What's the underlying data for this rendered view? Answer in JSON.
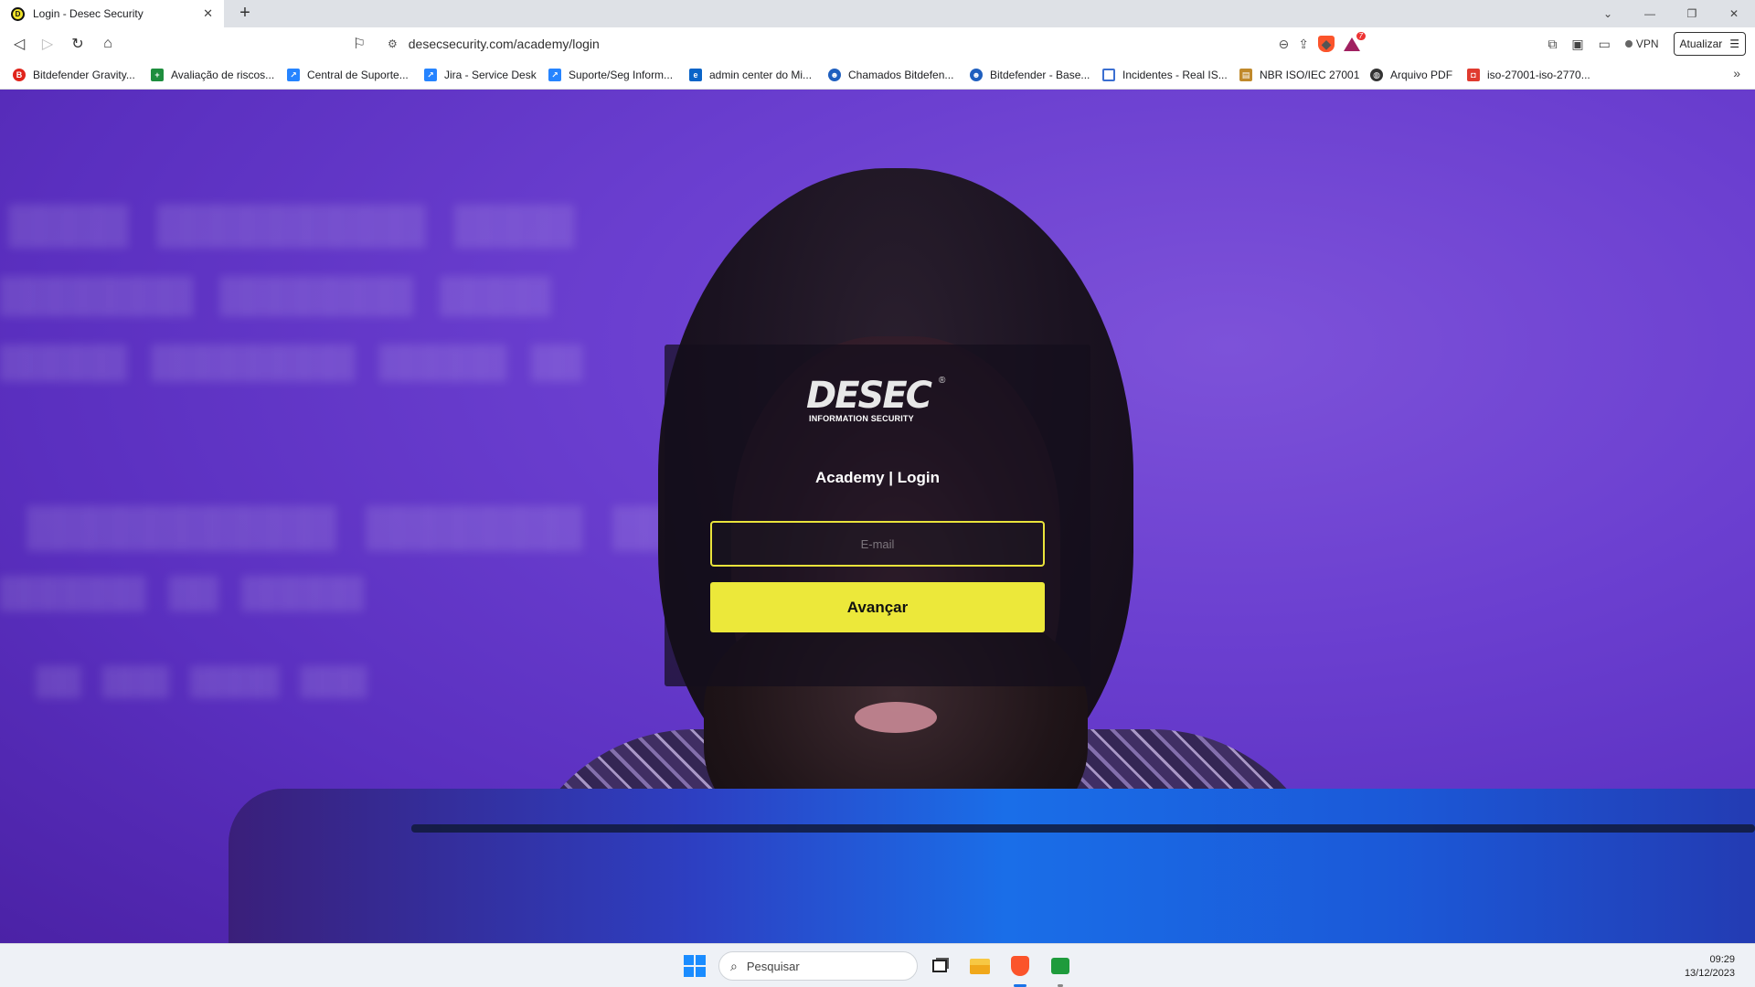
{
  "browser": {
    "tab_title": "Login - Desec Security",
    "tab_favicon": "D",
    "new_tab_label": "+",
    "url": "desecsecurity.com/academy/login",
    "rewards_badge": "7",
    "vpn_label": "VPN",
    "update_label": "Atualizar"
  },
  "bookmarks": [
    {
      "label": "Bitdefender Gravity...",
      "icon": "bitdefender-icon",
      "color": "#e0241b"
    },
    {
      "label": "Avaliação de riscos...",
      "icon": "sheets-icon",
      "color": "#1e8e3e"
    },
    {
      "label": "Central de Suporte...",
      "icon": "jira-icon",
      "color": "#2684ff"
    },
    {
      "label": "Jira - Service Desk",
      "icon": "jira-icon",
      "color": "#2684ff"
    },
    {
      "label": "Suporte/Seg Inform...",
      "icon": "jira-icon",
      "color": "#2684ff"
    },
    {
      "label": "admin center do Mi...",
      "icon": "exchange-icon",
      "color": "#0a64c8"
    },
    {
      "label": "Chamados Bitdefen...",
      "icon": "support-agent-icon",
      "color": "#1f5fbf"
    },
    {
      "label": "Bitdefender - Base...",
      "icon": "support-agent-icon",
      "color": "#1f5fbf"
    },
    {
      "label": "Incidentes - Real IS...",
      "icon": "calendar-icon",
      "color": "#3b6fd1"
    },
    {
      "label": "NBR ISO/IEC 27001",
      "icon": "doc-stamp-icon",
      "color": "#c0892b"
    },
    {
      "label": "Arquivo PDF",
      "icon": "globe-icon",
      "color": "#333333"
    },
    {
      "label": "iso-27001-iso-2770...",
      "icon": "pdf-icon",
      "color": "#e03b2f"
    }
  ],
  "page": {
    "logo_text": "DESEC",
    "logo_registered": "®",
    "logo_subtitle": "INFORMATION SECURITY",
    "title": "Academy | Login",
    "email_placeholder": "E-mail",
    "email_value": "",
    "submit_label": "Avançar",
    "accent_color": "#ece83a",
    "background_color": "#6b3fd0"
  },
  "taskbar": {
    "search_placeholder": "Pesquisar",
    "time": "09:29",
    "date": "13/12/2023"
  }
}
